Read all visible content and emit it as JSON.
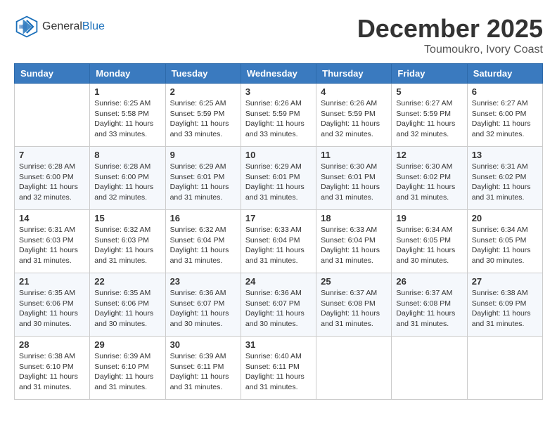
{
  "header": {
    "logo_general": "General",
    "logo_blue": "Blue",
    "month": "December 2025",
    "location": "Toumoukro, Ivory Coast"
  },
  "weekdays": [
    "Sunday",
    "Monday",
    "Tuesday",
    "Wednesday",
    "Thursday",
    "Friday",
    "Saturday"
  ],
  "weeks": [
    [
      {
        "day": "",
        "info": ""
      },
      {
        "day": "1",
        "info": "Sunrise: 6:25 AM\nSunset: 5:58 PM\nDaylight: 11 hours\nand 33 minutes."
      },
      {
        "day": "2",
        "info": "Sunrise: 6:25 AM\nSunset: 5:59 PM\nDaylight: 11 hours\nand 33 minutes."
      },
      {
        "day": "3",
        "info": "Sunrise: 6:26 AM\nSunset: 5:59 PM\nDaylight: 11 hours\nand 33 minutes."
      },
      {
        "day": "4",
        "info": "Sunrise: 6:26 AM\nSunset: 5:59 PM\nDaylight: 11 hours\nand 32 minutes."
      },
      {
        "day": "5",
        "info": "Sunrise: 6:27 AM\nSunset: 5:59 PM\nDaylight: 11 hours\nand 32 minutes."
      },
      {
        "day": "6",
        "info": "Sunrise: 6:27 AM\nSunset: 6:00 PM\nDaylight: 11 hours\nand 32 minutes."
      }
    ],
    [
      {
        "day": "7",
        "info": "Sunrise: 6:28 AM\nSunset: 6:00 PM\nDaylight: 11 hours\nand 32 minutes."
      },
      {
        "day": "8",
        "info": "Sunrise: 6:28 AM\nSunset: 6:00 PM\nDaylight: 11 hours\nand 32 minutes."
      },
      {
        "day": "9",
        "info": "Sunrise: 6:29 AM\nSunset: 6:01 PM\nDaylight: 11 hours\nand 31 minutes."
      },
      {
        "day": "10",
        "info": "Sunrise: 6:29 AM\nSunset: 6:01 PM\nDaylight: 11 hours\nand 31 minutes."
      },
      {
        "day": "11",
        "info": "Sunrise: 6:30 AM\nSunset: 6:01 PM\nDaylight: 11 hours\nand 31 minutes."
      },
      {
        "day": "12",
        "info": "Sunrise: 6:30 AM\nSunset: 6:02 PM\nDaylight: 11 hours\nand 31 minutes."
      },
      {
        "day": "13",
        "info": "Sunrise: 6:31 AM\nSunset: 6:02 PM\nDaylight: 11 hours\nand 31 minutes."
      }
    ],
    [
      {
        "day": "14",
        "info": "Sunrise: 6:31 AM\nSunset: 6:03 PM\nDaylight: 11 hours\nand 31 minutes."
      },
      {
        "day": "15",
        "info": "Sunrise: 6:32 AM\nSunset: 6:03 PM\nDaylight: 11 hours\nand 31 minutes."
      },
      {
        "day": "16",
        "info": "Sunrise: 6:32 AM\nSunset: 6:04 PM\nDaylight: 11 hours\nand 31 minutes."
      },
      {
        "day": "17",
        "info": "Sunrise: 6:33 AM\nSunset: 6:04 PM\nDaylight: 11 hours\nand 31 minutes."
      },
      {
        "day": "18",
        "info": "Sunrise: 6:33 AM\nSunset: 6:04 PM\nDaylight: 11 hours\nand 31 minutes."
      },
      {
        "day": "19",
        "info": "Sunrise: 6:34 AM\nSunset: 6:05 PM\nDaylight: 11 hours\nand 30 minutes."
      },
      {
        "day": "20",
        "info": "Sunrise: 6:34 AM\nSunset: 6:05 PM\nDaylight: 11 hours\nand 30 minutes."
      }
    ],
    [
      {
        "day": "21",
        "info": "Sunrise: 6:35 AM\nSunset: 6:06 PM\nDaylight: 11 hours\nand 30 minutes."
      },
      {
        "day": "22",
        "info": "Sunrise: 6:35 AM\nSunset: 6:06 PM\nDaylight: 11 hours\nand 30 minutes."
      },
      {
        "day": "23",
        "info": "Sunrise: 6:36 AM\nSunset: 6:07 PM\nDaylight: 11 hours\nand 30 minutes."
      },
      {
        "day": "24",
        "info": "Sunrise: 6:36 AM\nSunset: 6:07 PM\nDaylight: 11 hours\nand 30 minutes."
      },
      {
        "day": "25",
        "info": "Sunrise: 6:37 AM\nSunset: 6:08 PM\nDaylight: 11 hours\nand 31 minutes."
      },
      {
        "day": "26",
        "info": "Sunrise: 6:37 AM\nSunset: 6:08 PM\nDaylight: 11 hours\nand 31 minutes."
      },
      {
        "day": "27",
        "info": "Sunrise: 6:38 AM\nSunset: 6:09 PM\nDaylight: 11 hours\nand 31 minutes."
      }
    ],
    [
      {
        "day": "28",
        "info": "Sunrise: 6:38 AM\nSunset: 6:10 PM\nDaylight: 11 hours\nand 31 minutes."
      },
      {
        "day": "29",
        "info": "Sunrise: 6:39 AM\nSunset: 6:10 PM\nDaylight: 11 hours\nand 31 minutes."
      },
      {
        "day": "30",
        "info": "Sunrise: 6:39 AM\nSunset: 6:11 PM\nDaylight: 11 hours\nand 31 minutes."
      },
      {
        "day": "31",
        "info": "Sunrise: 6:40 AM\nSunset: 6:11 PM\nDaylight: 11 hours\nand 31 minutes."
      },
      {
        "day": "",
        "info": ""
      },
      {
        "day": "",
        "info": ""
      },
      {
        "day": "",
        "info": ""
      }
    ]
  ]
}
